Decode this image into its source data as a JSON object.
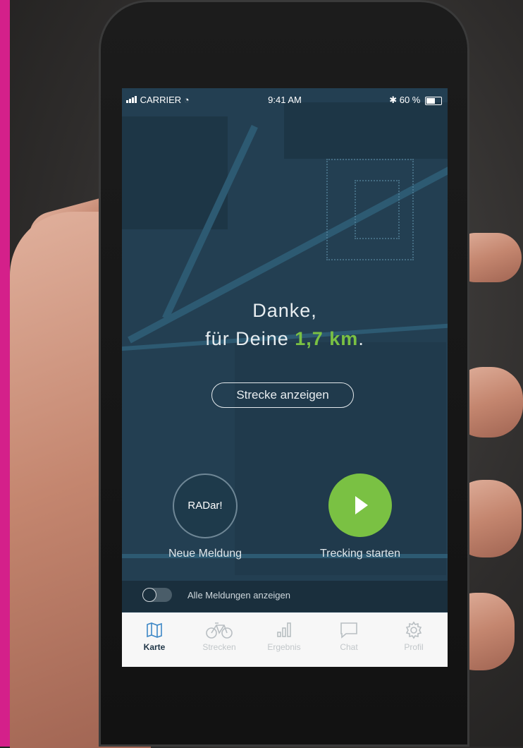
{
  "status_bar": {
    "carrier": "CARRIER",
    "time": "9:41 AM",
    "battery": "60 %"
  },
  "headline": {
    "line1": "Danke,",
    "line2_prefix": "für Deine",
    "distance": "1,7 km",
    "suffix": "."
  },
  "route_button_label": "Strecke anzeigen",
  "actions": {
    "radar_label": "RADar!",
    "report_caption": "Neue Meldung",
    "tracking_caption": "Trecking starten"
  },
  "toggle": {
    "label": "Alle Meldungen anzeigen",
    "on": false
  },
  "tabs": [
    {
      "label": "Karte",
      "icon": "map-icon",
      "active": true
    },
    {
      "label": "Strecken",
      "icon": "bicycle-icon",
      "active": false
    },
    {
      "label": "Ergebnis",
      "icon": "bar-chart-icon",
      "active": false
    },
    {
      "label": "Chat",
      "icon": "chat-icon",
      "active": false
    },
    {
      "label": "Profil",
      "icon": "gear-icon",
      "active": false
    }
  ],
  "colors": {
    "accent_green": "#7ac143",
    "active_tab_blue": "#3c87c6",
    "map_background": "#233f52",
    "brand_pink": "#d4208a"
  }
}
